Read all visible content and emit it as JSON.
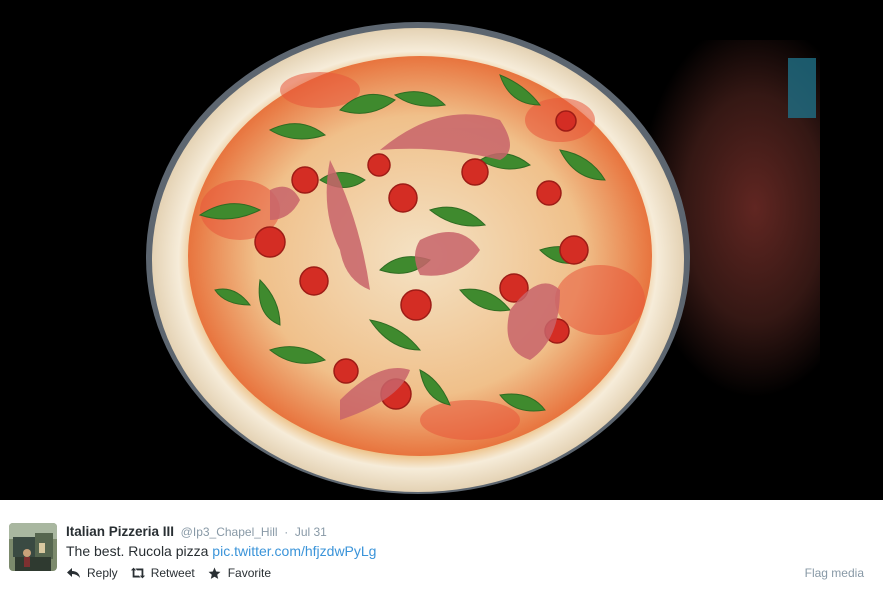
{
  "media": {
    "icon": "photo-image",
    "colors": {
      "background": "#000000",
      "crust": "#f1e6d2",
      "sauce": "#e8553a",
      "arugula": "#3f8a2e",
      "tomato": "#d42d24",
      "prosciutto": "#c8646a"
    }
  },
  "tweet": {
    "avatar_icon": "user-avatar",
    "fullname": "Italian Pizzeria III",
    "username": "@Ip3_Chapel_Hill",
    "separator": "·",
    "timestamp": "Jul 31",
    "text": "The best. Rucola pizza ",
    "link": "pic.twitter.com/hfjzdwPyLg",
    "link_color": "#3b94d9"
  },
  "actions": {
    "reply": {
      "label": "Reply",
      "icon": "reply-icon"
    },
    "retweet": {
      "label": "Retweet",
      "icon": "retweet-icon"
    },
    "favorite": {
      "label": "Favorite",
      "icon": "star-icon"
    },
    "flag": {
      "label": "Flag media"
    }
  }
}
